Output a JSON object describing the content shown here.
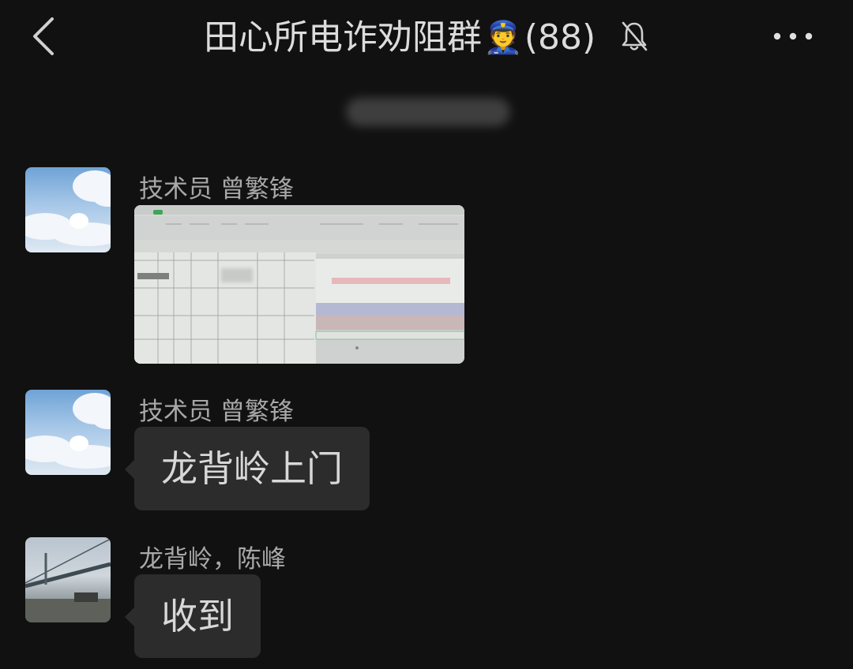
{
  "header": {
    "title_text": "田心所电诈劝阻群",
    "title_emoji": "👮",
    "member_count": "(88)",
    "back_icon": "chevron-left-icon",
    "mute_icon": "bell-off-icon",
    "more_icon": "more-horizontal-icon"
  },
  "messages": [
    {
      "sender": "技术员 曾繁锋",
      "type": "image",
      "avatar": "sky-cloud-avatar"
    },
    {
      "sender": "技术员 曾繁锋",
      "type": "text",
      "text": "龙背岭上门",
      "avatar": "sky-cloud-avatar"
    },
    {
      "sender": "龙背岭，陈峰",
      "type": "text",
      "text": "收到",
      "avatar": "bridge-avatar"
    }
  ],
  "colors": {
    "background": "#111111",
    "bubble": "#2c2c2c",
    "text": "#d8d8d8",
    "sender": "#a8a8a8"
  }
}
